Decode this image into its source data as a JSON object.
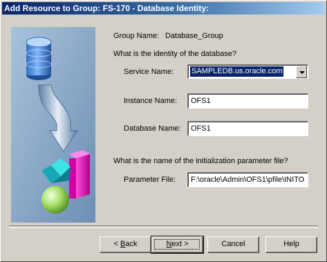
{
  "window": {
    "title": "Add Resource to Group: FS-170 - Database Identity:"
  },
  "group": {
    "label": "Group Name:",
    "value": "Database_Group"
  },
  "identity_question": "What is the identity of the database?",
  "service": {
    "label": "Service Name:",
    "value": "SAMPLEDB.us.oracle.com"
  },
  "instance": {
    "label": "Instance Name:",
    "value": "OFS1"
  },
  "database": {
    "label": "Database Name:",
    "value": "OFS1"
  },
  "param_question": "What is the name of the initialization parameter file?",
  "param_file": {
    "label": "Parameter File:",
    "value": "F:\\oracle\\Admin\\OFS1\\pfile\\INITO"
  },
  "buttons": {
    "back_prefix": "< ",
    "back_mnemonic": "B",
    "back_rest": "ack",
    "next_mnemonic": "N",
    "next_rest": "ext >",
    "cancel": "Cancel",
    "help": "Help"
  },
  "colors": {
    "titlebar_start": "#0a246a",
    "titlebar_end": "#a6caf0",
    "dialog_face": "#d4d0c8",
    "selection": "#0a246a"
  },
  "icons": [
    "database-cylinder-icon",
    "flow-arrow-icon",
    "shapes-icon",
    "dropdown-arrow-icon"
  ]
}
